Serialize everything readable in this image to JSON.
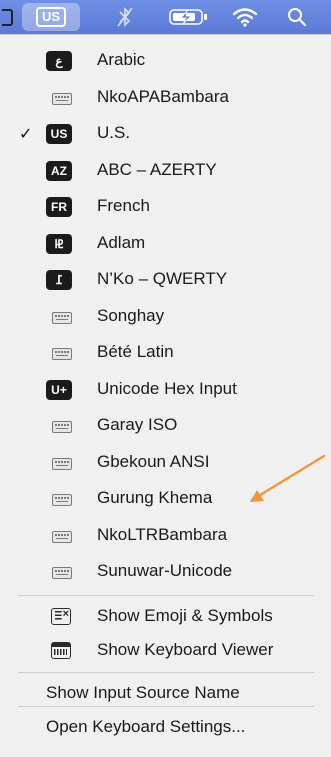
{
  "menubar": {
    "input_source_badge": "US",
    "icons": [
      "window-edge-icon",
      "bluetooth-off-icon",
      "battery-charging-icon",
      "wifi-icon",
      "search-icon"
    ]
  },
  "menu": {
    "sources": [
      {
        "badge": "ع",
        "label": "Arabic",
        "icon": "badge",
        "checked": false
      },
      {
        "badge": "",
        "label": "NkoAPABambara",
        "icon": "keyboard",
        "checked": false
      },
      {
        "badge": "US",
        "label": "U.S.",
        "icon": "badge",
        "checked": true
      },
      {
        "badge": "AZ",
        "label": "ABC – AZERTY",
        "icon": "badge",
        "checked": false
      },
      {
        "badge": "FR",
        "label": "French",
        "icon": "badge",
        "checked": false
      },
      {
        "badge": "𞤄",
        "label": "Adlam",
        "icon": "badge",
        "checked": false
      },
      {
        "badge": "߁",
        "label": "N’Ko – QWERTY",
        "icon": "badge",
        "checked": false
      },
      {
        "badge": "",
        "label": "Songhay",
        "icon": "keyboard",
        "checked": false
      },
      {
        "badge": "",
        "label": "Bété Latin",
        "icon": "keyboard",
        "checked": false
      },
      {
        "badge": "U+",
        "label": "Unicode Hex Input",
        "icon": "badge",
        "checked": false
      },
      {
        "badge": "",
        "label": " Garay ISO",
        "icon": "keyboard",
        "checked": false
      },
      {
        "badge": "",
        "label": "Gbekoun ANSI",
        "icon": "keyboard",
        "checked": false
      },
      {
        "badge": "",
        "label": "Gurung Khema",
        "icon": "keyboard",
        "checked": false
      },
      {
        "badge": "",
        "label": "NkoLTRBambara",
        "icon": "keyboard",
        "checked": false
      },
      {
        "badge": "",
        "label": "Sunuwar-Unicode",
        "icon": "keyboard",
        "checked": false
      }
    ],
    "check_mark": "✓",
    "show_emoji": "Show Emoji & Symbols",
    "show_keyboard_viewer": "Show Keyboard Viewer",
    "show_input_source_name": "Show Input Source Name",
    "open_keyboard_settings": "Open Keyboard Settings..."
  },
  "annotation": {
    "arrow_color": "#f0953a"
  },
  "colors": {
    "menubar": "#5b7fd6",
    "menu_bg": "#f1f0f0",
    "badge_bg": "#1b1b1b"
  }
}
